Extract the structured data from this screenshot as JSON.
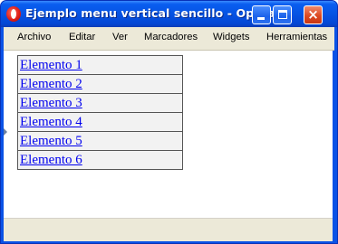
{
  "window": {
    "title": "Ejemplo menu vertical sencillo - Opera"
  },
  "title_buttons": {
    "minimize": "minimize",
    "maximize": "maximize",
    "close": "×"
  },
  "menubar": {
    "items": [
      "Archivo",
      "Editar",
      "Ver",
      "Marcadores",
      "Widgets",
      "Herramientas"
    ]
  },
  "page": {
    "links": [
      "Elemento 1",
      "Elemento 2",
      "Elemento 3",
      "Elemento 4",
      "Elemento 5",
      "Elemento 6"
    ]
  },
  "colors": {
    "titlebar": "#0553e3",
    "menubar": "#ece9d8",
    "link": "#0000ee",
    "menu_row_bg": "#f2f2f2",
    "menu_border": "#555555"
  }
}
